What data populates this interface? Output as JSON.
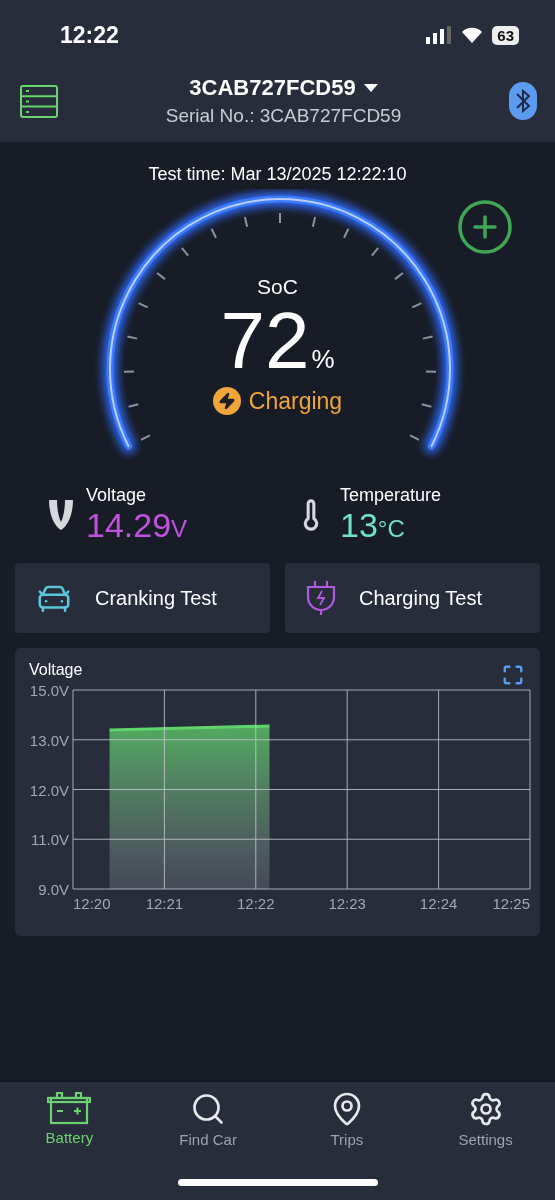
{
  "status_bar": {
    "time": "12:22",
    "battery": "63"
  },
  "header": {
    "device": "3CAB727FCD59",
    "serial": "Serial No.: 3CAB727FCD59"
  },
  "test_time": "Test time: Mar 13/2025 12:22:10",
  "gauge": {
    "label": "SoC",
    "value": "72",
    "unit": "%",
    "status": "Charging"
  },
  "readings": [
    {
      "kind": "voltage",
      "label": "Voltage",
      "value": "14.29",
      "unit": "V",
      "color": "#c152e0"
    },
    {
      "kind": "temperature",
      "label": "Temperature",
      "value": "13",
      "unit": "°C",
      "color": "#6fe3c4"
    }
  ],
  "tests": [
    {
      "kind": "cranking",
      "label": "Cranking Test"
    },
    {
      "kind": "charging",
      "label": "Charging Test"
    }
  ],
  "chart": {
    "title": "Voltage",
    "y_labels": [
      "15.0V",
      "13.0V",
      "12.0V",
      "11.0V",
      "9.0V"
    ],
    "x_labels": [
      "12:20",
      "12:21",
      "12:22",
      "12:23",
      "12:24",
      "12:25"
    ]
  },
  "nav": [
    {
      "kind": "battery",
      "label": "Battery",
      "selected": true
    },
    {
      "kind": "find",
      "label": "Find Car",
      "selected": false
    },
    {
      "kind": "trips",
      "label": "Trips",
      "selected": false
    },
    {
      "kind": "settings",
      "label": "Settings",
      "selected": false
    }
  ]
}
